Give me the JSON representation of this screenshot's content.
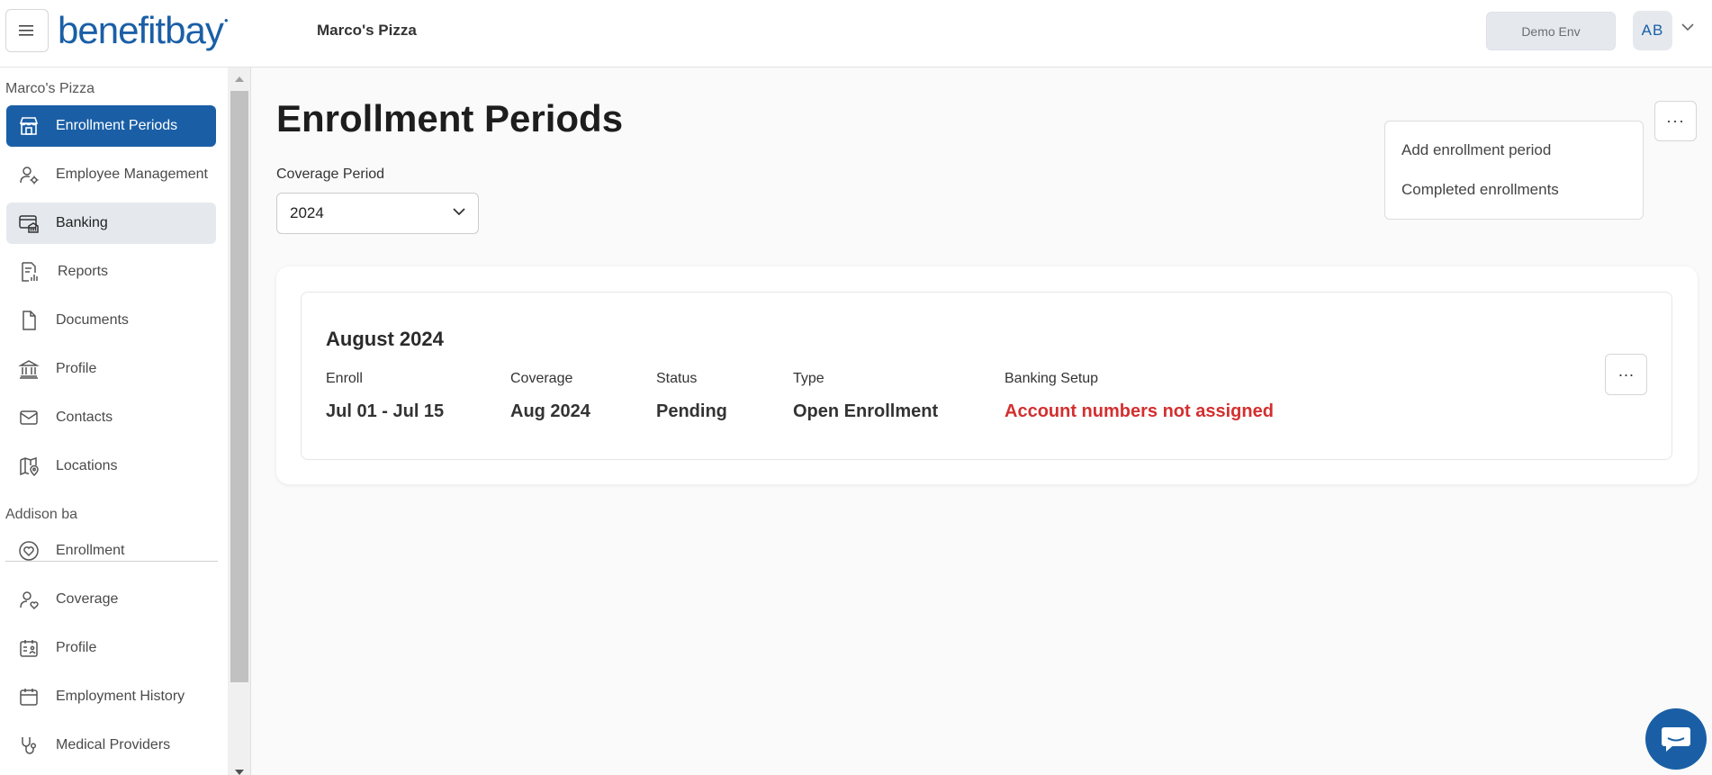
{
  "header": {
    "logo_text": "benefitbay",
    "company": "Marco's Pizza",
    "env_label": "Demo Env",
    "avatar_initials": "AB"
  },
  "sidebar": {
    "employer_section": "Marco's Pizza",
    "employer_items": [
      {
        "label": "Enrollment Periods",
        "icon": "store-icon",
        "state": "active"
      },
      {
        "label": "Employee Management",
        "icon": "user-gear-icon",
        "state": "normal"
      },
      {
        "label": "Banking",
        "icon": "bank-card-icon",
        "state": "hover"
      },
      {
        "label": "Reports",
        "icon": "report-icon",
        "state": "normal"
      },
      {
        "label": "Documents",
        "icon": "document-icon",
        "state": "normal"
      },
      {
        "label": "Profile",
        "icon": "building-icon",
        "state": "normal"
      },
      {
        "label": "Contacts",
        "icon": "mail-icon",
        "state": "normal"
      },
      {
        "label": "Locations",
        "icon": "map-pin-icon",
        "state": "normal"
      }
    ],
    "employee_section": "Addison ba",
    "employee_items": [
      {
        "label": "Enrollment",
        "icon": "heart-icon"
      },
      {
        "label": "Coverage",
        "icon": "user-heart-icon"
      },
      {
        "label": "Profile",
        "icon": "calendar-user-icon"
      },
      {
        "label": "Employment History",
        "icon": "calendar-icon"
      },
      {
        "label": "Medical Providers",
        "icon": "stethoscope-icon"
      }
    ]
  },
  "main": {
    "title": "Enrollment Periods",
    "coverage_label": "Coverage Period",
    "coverage_value": "2024",
    "more_label": "···",
    "menu": {
      "items": [
        "Add enrollment period",
        "Completed enrollments"
      ]
    },
    "card": {
      "title": "August 2024",
      "more_label": "···",
      "columns": [
        {
          "label": "Enroll",
          "value": "Jul 01 - Jul 15"
        },
        {
          "label": "Coverage",
          "value": "Aug 2024"
        },
        {
          "label": "Status",
          "value": "Pending"
        },
        {
          "label": "Type",
          "value": "Open Enrollment"
        },
        {
          "label": "Banking Setup",
          "value": "Account numbers not assigned"
        }
      ]
    }
  },
  "colors": {
    "brand": "#1a5fa6",
    "warning": "#d32f2f"
  }
}
